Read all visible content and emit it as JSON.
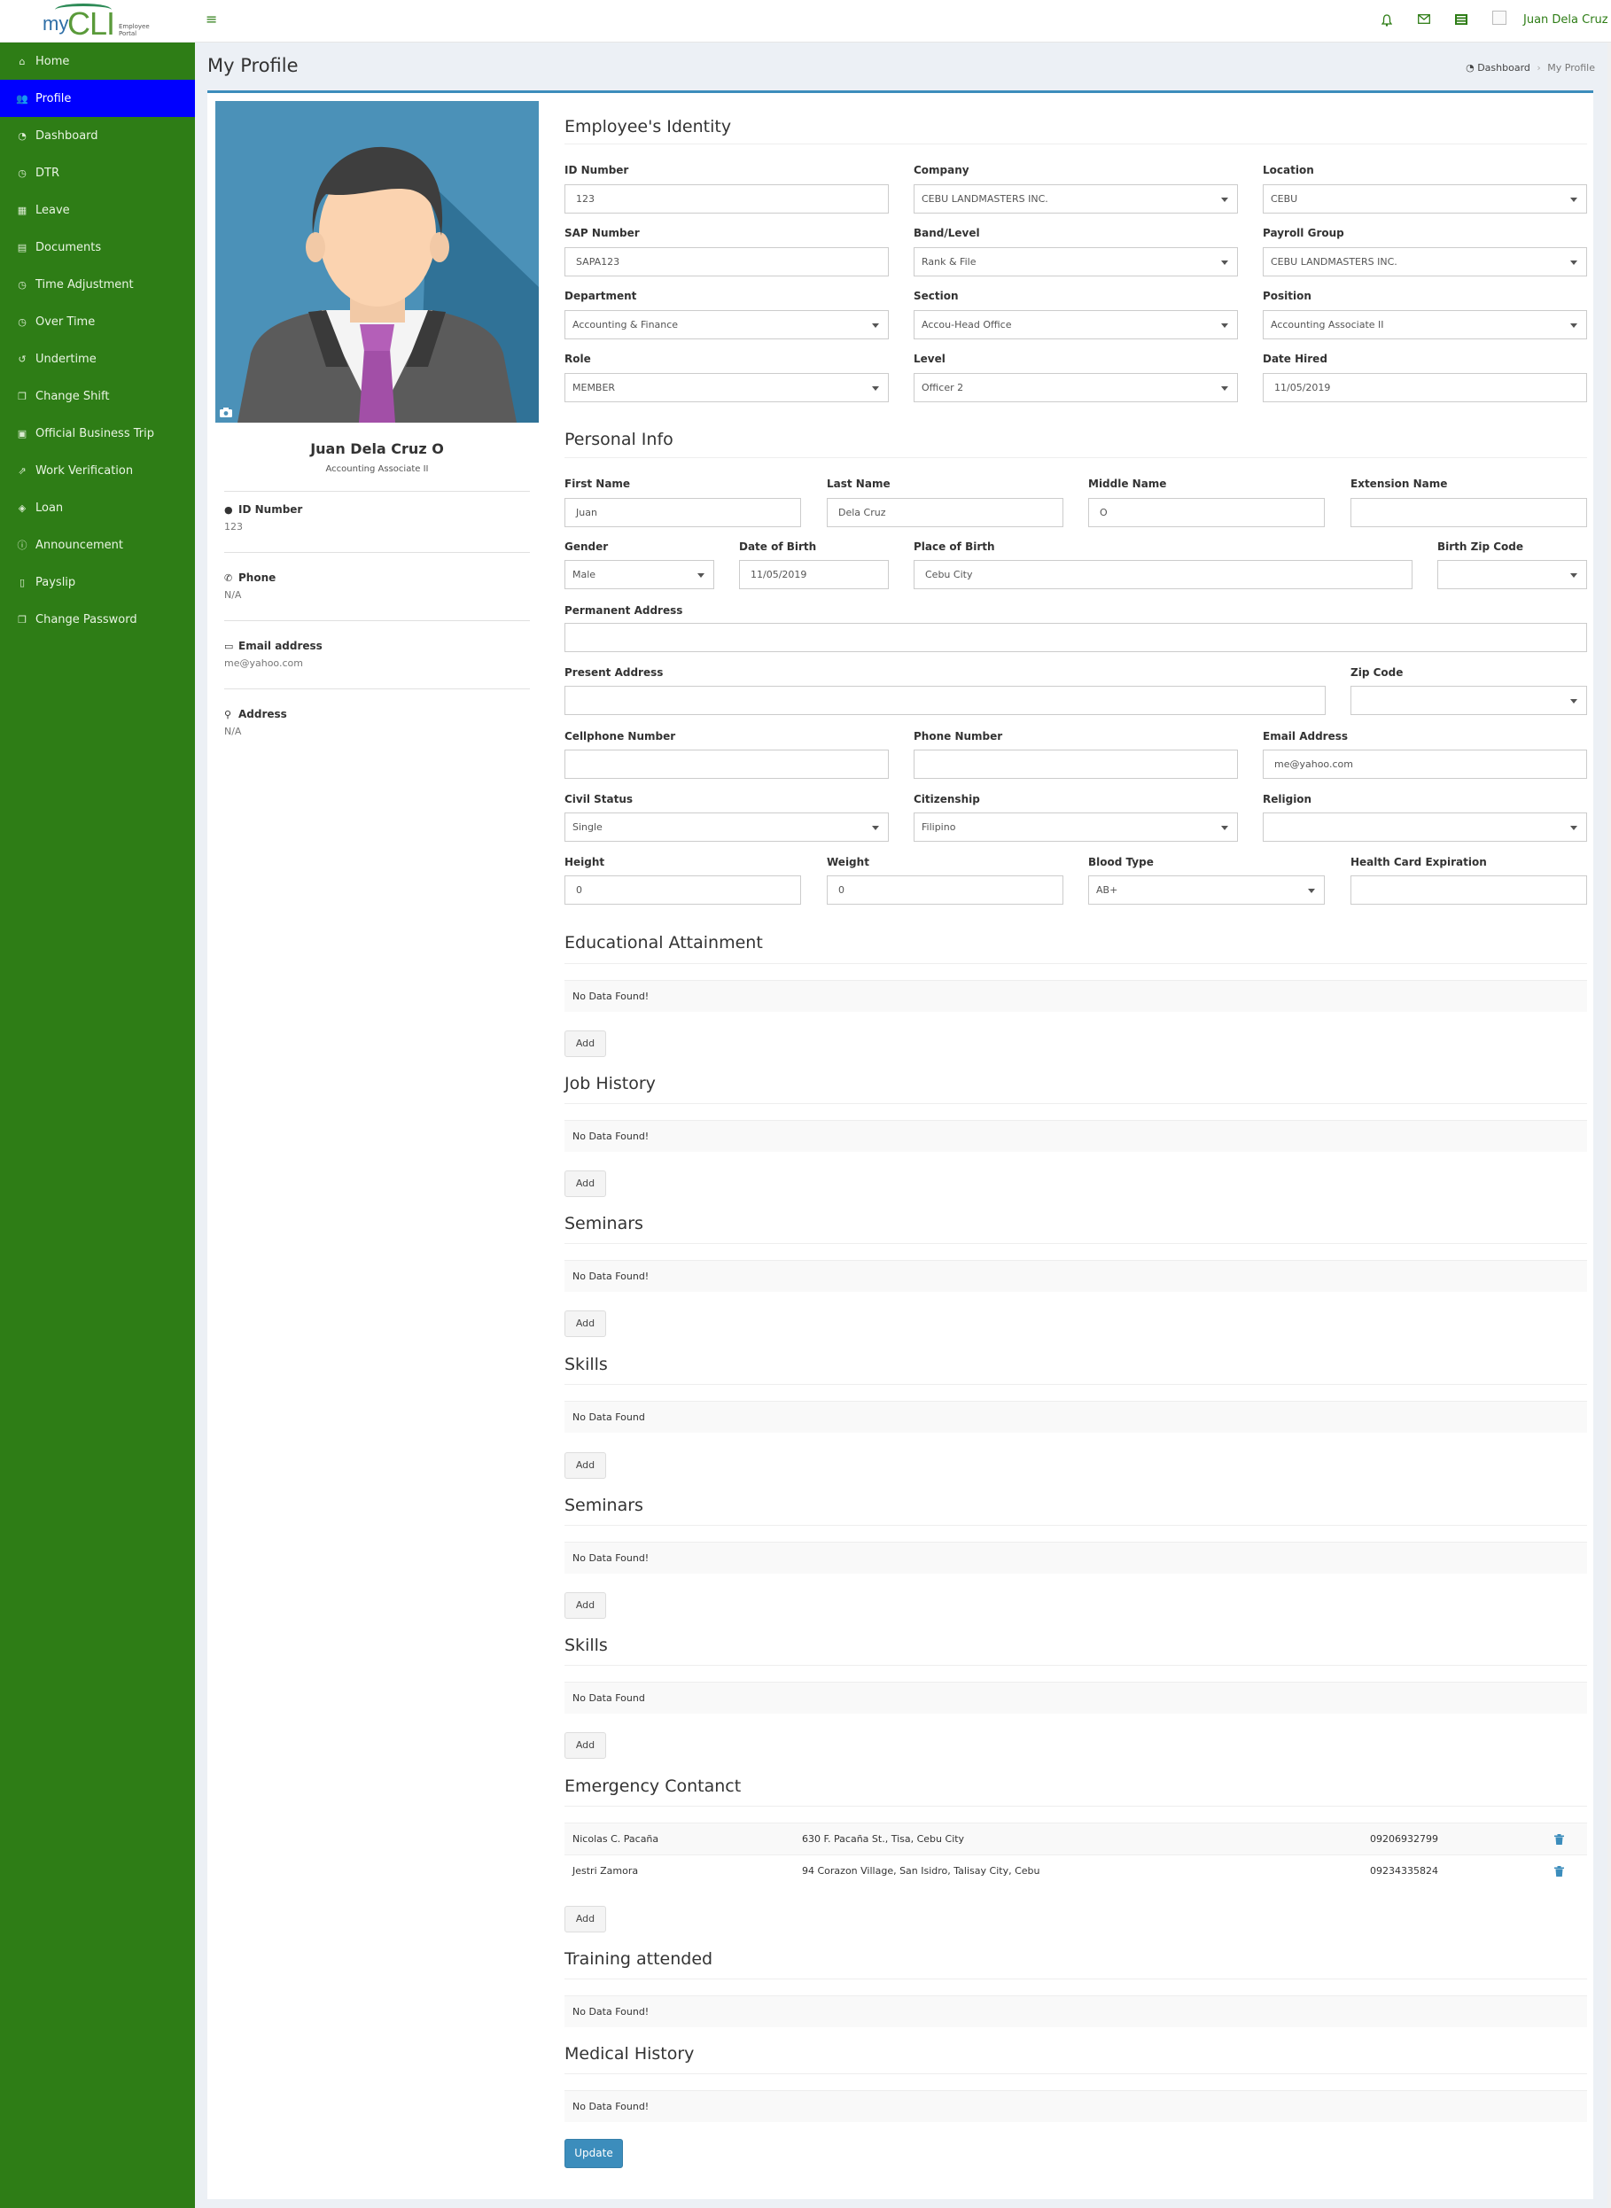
{
  "app": {
    "logo_my": "my",
    "logo_cli": "CLI",
    "logo_sub": "Employee Portal",
    "user_name": "Juan Dela Cruz"
  },
  "icons": {
    "menu": "hamburger-menu-icon",
    "notifications": "bell-icon",
    "messages": "envelope-icon",
    "tasks": "list-icon",
    "camera": "camera-icon",
    "trash": "trash-icon"
  },
  "colors": {
    "sidebar": "#2e7d16",
    "sidebar_active": "#0000ff",
    "accent": "#3c8dbc",
    "link": "#2e7d16"
  },
  "sidebar": {
    "items": [
      {
        "label": "Home",
        "icon": "home-icon",
        "glyph": "⌂"
      },
      {
        "label": "Profile",
        "icon": "users-icon",
        "glyph": "👥",
        "active": true
      },
      {
        "label": "Dashboard",
        "icon": "dashboard-icon",
        "glyph": "◔"
      },
      {
        "label": "DTR",
        "icon": "clock-icon",
        "glyph": "◷"
      },
      {
        "label": "Leave",
        "icon": "calendar-icon",
        "glyph": "▦"
      },
      {
        "label": "Documents",
        "icon": "document-icon",
        "glyph": "▤"
      },
      {
        "label": "Time Adjustment",
        "icon": "clock-icon",
        "glyph": "◷"
      },
      {
        "label": "Over Time",
        "icon": "clock-icon",
        "glyph": "◷"
      },
      {
        "label": "Undertime",
        "icon": "history-icon",
        "glyph": "↺"
      },
      {
        "label": "Change Shift",
        "icon": "files-icon",
        "glyph": "❐"
      },
      {
        "label": "Official Business Trip",
        "icon": "briefcase-icon",
        "glyph": "▣"
      },
      {
        "label": "Work Verification",
        "icon": "external-link-icon",
        "glyph": "⇗"
      },
      {
        "label": "Loan",
        "icon": "tag-icon",
        "glyph": "◈"
      },
      {
        "label": "Announcement",
        "icon": "info-icon",
        "glyph": "ⓘ"
      },
      {
        "label": "Payslip",
        "icon": "file-icon",
        "glyph": "▯"
      },
      {
        "label": "Change Password",
        "icon": "files-icon",
        "glyph": "❐"
      }
    ]
  },
  "header": {
    "title": "My Profile",
    "breadcrumb": [
      "Dashboard",
      "My Profile"
    ]
  },
  "profile": {
    "name": "Juan Dela Cruz O",
    "position": "Accounting Associate II",
    "info": [
      {
        "label": "ID Number",
        "value": "123",
        "icon": "user-icon",
        "glyph": "●"
      },
      {
        "label": "Phone",
        "value": "N/A",
        "icon": "phone-icon",
        "glyph": "✆"
      },
      {
        "label": "Email address",
        "value": "me@yahoo.com",
        "icon": "email-icon",
        "glyph": "▭"
      },
      {
        "label": "Address",
        "value": "N/A",
        "icon": "map-marker-icon",
        "glyph": "⚲"
      }
    ]
  },
  "identity": {
    "title": "Employee's Identity",
    "id_number": {
      "label": "ID Number",
      "value": "123"
    },
    "company": {
      "label": "Company",
      "value": "CEBU LANDMASTERS INC."
    },
    "location": {
      "label": "Location",
      "value": "CEBU"
    },
    "sap_number": {
      "label": "SAP Number",
      "value": "SAPA123"
    },
    "band_level": {
      "label": "Band/Level",
      "value": "Rank & File"
    },
    "payroll_group": {
      "label": "Payroll Group",
      "value": "CEBU LANDMASTERS INC."
    },
    "department": {
      "label": "Department",
      "value": "Accounting & Finance"
    },
    "section": {
      "label": "Section",
      "value": "Accou-Head Office"
    },
    "position": {
      "label": "Position",
      "value": "Accounting Associate II"
    },
    "role": {
      "label": "Role",
      "value": "MEMBER"
    },
    "level": {
      "label": "Level",
      "value": "Officer 2"
    },
    "date_hired": {
      "label": "Date Hired",
      "value": "11/05/2019"
    }
  },
  "personal": {
    "title": "Personal Info",
    "first_name": {
      "label": "First Name",
      "value": "Juan"
    },
    "last_name": {
      "label": "Last Name",
      "value": "Dela Cruz"
    },
    "middle_name": {
      "label": "Middle Name",
      "value": "O"
    },
    "extension_name": {
      "label": "Extension Name",
      "value": ""
    },
    "gender": {
      "label": "Gender",
      "value": "Male"
    },
    "date_of_birth": {
      "label": "Date of Birth",
      "value": "11/05/2019"
    },
    "place_of_birth": {
      "label": "Place of Birth",
      "value": "Cebu City"
    },
    "birth_zip_code": {
      "label": "Birth Zip Code",
      "value": ""
    },
    "permanent_address": {
      "label": "Permanent Address",
      "value": ""
    },
    "present_address": {
      "label": "Present Address",
      "value": ""
    },
    "zip_code": {
      "label": "Zip Code",
      "value": ""
    },
    "cellphone": {
      "label": "Cellphone Number",
      "value": ""
    },
    "phone": {
      "label": "Phone Number",
      "value": ""
    },
    "email": {
      "label": "Email Address",
      "value": "me@yahoo.com"
    },
    "civil_status": {
      "label": "Civil Status",
      "value": "Single"
    },
    "citizenship": {
      "label": "Citizenship",
      "value": "Filipino"
    },
    "religion": {
      "label": "Religion",
      "value": ""
    },
    "height": {
      "label": "Height",
      "value": "0"
    },
    "weight": {
      "label": "Weight",
      "value": "0"
    },
    "blood_type": {
      "label": "Blood Type",
      "value": "AB+"
    },
    "health_card_expiration": {
      "label": "Health Card Expiration",
      "value": ""
    }
  },
  "sections": {
    "educational": {
      "title": "Educational Attainment",
      "empty": "No Data Found!"
    },
    "job_history": {
      "title": "Job History",
      "empty": "No Data Found!"
    },
    "seminars_1": {
      "title": "Seminars",
      "empty": "No Data Found!"
    },
    "skills_1": {
      "title": "Skills",
      "empty": "No Data Found"
    },
    "seminars_2": {
      "title": "Seminars",
      "empty": "No Data Found!"
    },
    "skills_2": {
      "title": "Skills",
      "empty": "No Data Found"
    },
    "emergency": {
      "title": "Emergency Contanct"
    },
    "training": {
      "title": "Training attended",
      "empty": "No Data Found!"
    },
    "medical": {
      "title": "Medical History",
      "empty": "No Data Found!"
    }
  },
  "emergency_contacts": [
    {
      "name": "Nicolas C. Pacaña",
      "address": "630 F. Pacaña St., Tisa, Cebu City",
      "phone": "09206932799"
    },
    {
      "name": "Jestri Zamora",
      "address": "94 Corazon Village, San Isidro, Talisay City, Cebu",
      "phone": "09234335824"
    }
  ],
  "buttons": {
    "add": "Add",
    "update": "Update"
  }
}
